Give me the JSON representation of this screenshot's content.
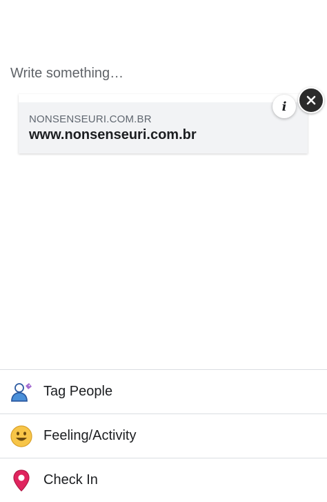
{
  "composer": {
    "placeholder": "Write something…"
  },
  "link_preview": {
    "domain": "NONSENSEURI.COM.BR",
    "title": "www.nonsenseuri.com.br"
  },
  "buttons": {
    "info_icon": "info-icon",
    "close_icon": "close-icon"
  },
  "actions": [
    {
      "label": "Tag People",
      "icon": "tag-people-icon"
    },
    {
      "label": "Feeling/Activity",
      "icon": "smiley-icon"
    },
    {
      "label": "Check In",
      "icon": "location-pin-icon"
    }
  ],
  "colors": {
    "card_bg": "#f2f3f5",
    "text_primary": "#1c1e21",
    "text_secondary": "#606770",
    "close_bg": "#2b2b2b",
    "tag_blue": "#4a90d9",
    "smiley_yellow": "#f7c548",
    "pin_red": "#e0245e"
  }
}
